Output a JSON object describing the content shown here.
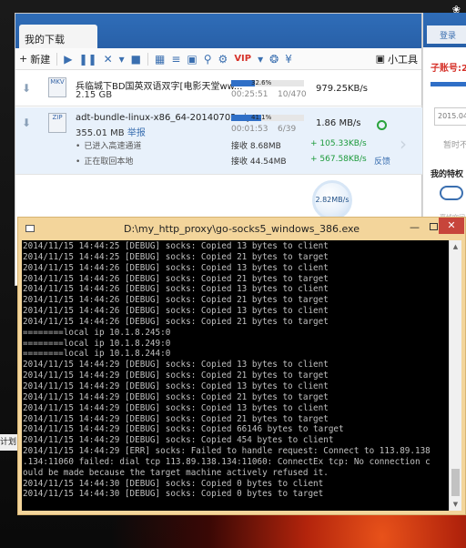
{
  "desktop": {
    "tray_icon": "❀"
  },
  "download_manager": {
    "tab_label": "我的下载",
    "toolbar": {
      "new_label": "新建",
      "vip_label": "VIP",
      "tools_label": "小工具"
    },
    "tasks": [
      {
        "file_badge": "MKV",
        "name": "兵临城下BD国英双语双字[电影天堂ww...",
        "size": "2.15 GB",
        "progress_text": "32.6%",
        "progress_fraction": 0.326,
        "elapsed": "00:25:51",
        "pieces": "10/470",
        "speed": "979.25KB/s"
      },
      {
        "file_badge": "ZIP",
        "name": "adt-bundle-linux-x86_64-20140702.zip",
        "size": "355.01 MB",
        "report_inline": "举报",
        "progress_text": "41.1%",
        "progress_fraction": 0.411,
        "elapsed": "00:01:53",
        "pieces": "6/39",
        "speed": "1.86   MB/s",
        "sub1": "已进入高速通道",
        "sub2": "正在取回本地",
        "recv1": "接收 8.68MB",
        "recv2": "接收 44.54MB",
        "plus1": "+ 105.33KB/s",
        "plus2": "+ 567.58KB/s",
        "report_label": "反馈"
      }
    ],
    "total_speed": "2.82MB/s"
  },
  "side_panel": {
    "button_label": "登录",
    "account_label": "子账号:2",
    "date_text": "2015.04",
    "nodata_text": "暂时不",
    "mine_label": "我的特权",
    "faint_text": "离线空间"
  },
  "left_edge_text": "计划",
  "console": {
    "title": "D:\\my_http_proxy\\go-socks5_windows_386.exe",
    "lines": [
      "2014/11/15 14:44:25 [DEBUG] socks: Copied 13 bytes to client",
      "2014/11/15 14:44:25 [DEBUG] socks: Copied 21 bytes to target",
      "2014/11/15 14:44:26 [DEBUG] socks: Copied 13 bytes to client",
      "2014/11/15 14:44:26 [DEBUG] socks: Copied 21 bytes to target",
      "2014/11/15 14:44:26 [DEBUG] socks: Copied 13 bytes to client",
      "2014/11/15 14:44:26 [DEBUG] socks: Copied 21 bytes to target",
      "2014/11/15 14:44:26 [DEBUG] socks: Copied 13 bytes to client",
      "2014/11/15 14:44:26 [DEBUG] socks: Copied 21 bytes to target",
      "========local ip 10.1.8.245:0",
      "========local ip 10.1.8.249:0",
      "========local ip 10.1.8.244:0",
      "2014/11/15 14:44:29 [DEBUG] socks: Copied 13 bytes to client",
      "2014/11/15 14:44:29 [DEBUG] socks: Copied 21 bytes to target",
      "2014/11/15 14:44:29 [DEBUG] socks: Copied 13 bytes to client",
      "2014/11/15 14:44:29 [DEBUG] socks: Copied 21 bytes to target",
      "2014/11/15 14:44:29 [DEBUG] socks: Copied 13 bytes to client",
      "2014/11/15 14:44:29 [DEBUG] socks: Copied 21 bytes to target",
      "2014/11/15 14:44:29 [DEBUG] socks: Copied 66146 bytes to target",
      "2014/11/15 14:44:29 [DEBUG] socks: Copied 454 bytes to client",
      "2014/11/15 14:44:29 [ERR] socks: Failed to handle request: Connect to 113.89.138",
      ".134:11060 failed: dial tcp 113.89.138.134:11060: ConnectEx tcp: No connection c",
      "ould be made because the target machine actively refused it.",
      "2014/11/15 14:44:30 [DEBUG] socks: Copied 0 bytes to client",
      "2014/11/15 14:44:30 [DEBUG] socks: Copied 0 bytes to target"
    ]
  }
}
